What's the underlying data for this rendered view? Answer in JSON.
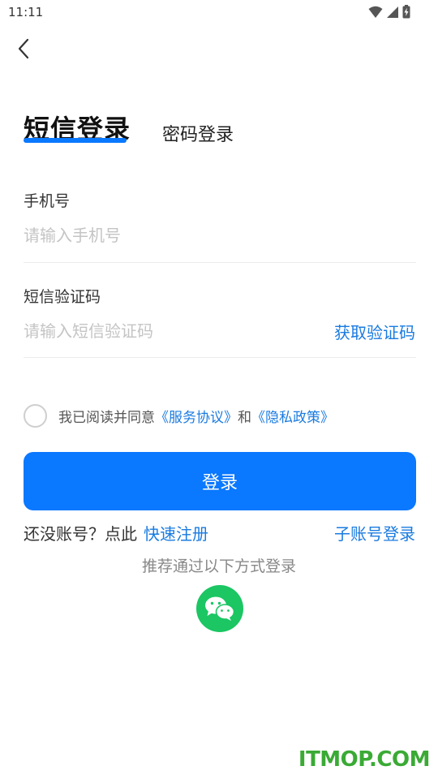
{
  "status_bar": {
    "time": "11:11",
    "icons": [
      "wifi-icon",
      "cell-signal-icon",
      "battery-charging-icon"
    ]
  },
  "nav": {
    "back_icon": "chevron-left-icon"
  },
  "tabs": {
    "sms_login": "短信登录",
    "password_login": "密码登录",
    "active": "sms_login"
  },
  "form": {
    "phone": {
      "label": "手机号",
      "value": "",
      "placeholder": "请输入手机号"
    },
    "sms_code": {
      "label": "短信验证码",
      "value": "",
      "placeholder": "请输入短信验证码"
    },
    "get_code_label": "获取验证码"
  },
  "agreement": {
    "checked": false,
    "prefix": "我已阅读并同意",
    "service_link": "《服务协议》",
    "conjunction": "和",
    "privacy_link": "《隐私政策》"
  },
  "login_button": "登录",
  "register": {
    "prompt": "还没账号？点此",
    "link": "快速注册"
  },
  "sub_account_login": "子账号登录",
  "alt_login_text": "推荐通过以下方式登录",
  "social": [
    {
      "icon": "wechat-icon"
    }
  ],
  "watermark": "ITMOP.COM",
  "colors": {
    "accent": "#0a78ff",
    "link": "#1a7be0",
    "wechat": "#1bc663",
    "watermark": "#3aaa35"
  }
}
